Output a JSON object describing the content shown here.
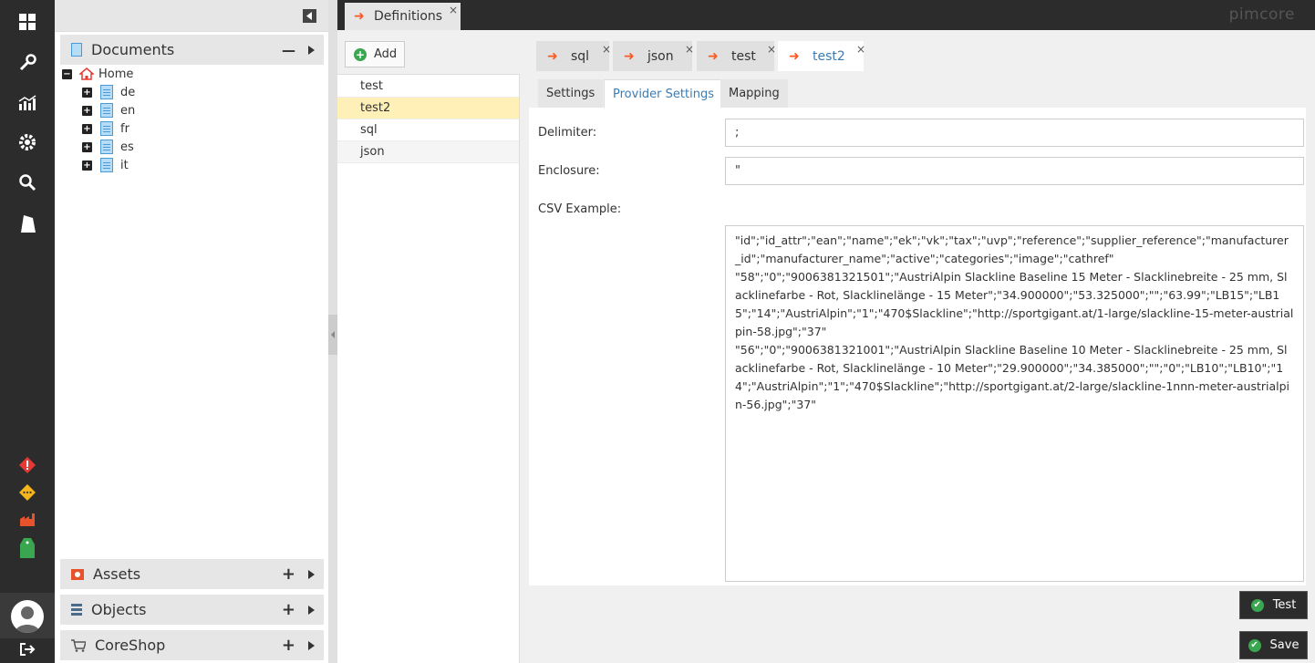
{
  "left_bar": {
    "icons": [
      "dashboard-icon",
      "wrench-icon",
      "chart-icon",
      "gear-icon",
      "search-icon",
      "tag-icon"
    ],
    "status_icons": [
      "error-icon",
      "warning-icon",
      "factory-icon",
      "green-tag-icon"
    ],
    "bottom_icons": [
      "avatar-icon",
      "logout-icon"
    ]
  },
  "tree": {
    "documents_label": "Documents",
    "home_label": "Home",
    "children": [
      "de",
      "en",
      "fr",
      "es",
      "it"
    ],
    "assets_label": "Assets",
    "objects_label": "Objects",
    "coreshop_label": "CoreShop"
  },
  "top": {
    "tab_label": "Definitions",
    "tab_close": "×",
    "logo": "pimcore"
  },
  "list": {
    "add_label": "Add",
    "items": [
      "test",
      "test2",
      "sql",
      "json"
    ],
    "selected_index": 1
  },
  "editor": {
    "open_tabs": [
      {
        "label": "sql",
        "close": "×"
      },
      {
        "label": "json",
        "close": "×"
      },
      {
        "label": "test",
        "close": "×"
      },
      {
        "label": "test2",
        "close": "×"
      }
    ],
    "active_tab": "test2",
    "sub_tabs": [
      "Settings",
      "Provider Settings",
      "Mapping"
    ],
    "active_sub_tab": "Provider Settings",
    "delimiter_label": "Delimiter:",
    "delimiter_value": ";",
    "enclosure_label": "Enclosure:",
    "enclosure_value": "\"",
    "csv_label": "CSV Example:",
    "csv_value": "\"id\";\"id_attr\";\"ean\";\"name\";\"ek\";\"vk\";\"tax\";\"uvp\";\"reference\";\"supplier_reference\";\"manufacturer_id\";\"manufacturer_name\";\"active\";\"categories\";\"image\";\"cathref\"\n\"58\";\"0\";\"9006381321501\";\"AustriAlpin Slackline Baseline 15 Meter - Slacklinebreite - 25 mm, Slacklinefarbe - Rot, Slacklinelänge - 15 Meter\";\"34.900000\";\"53.325000\";\"\";\"63.99\";\"LB15\";\"LB15\";\"14\";\"AustriAlpin\";\"1\";\"470$Slackline\";\"http://sportgigant.at/1-large/slackline-15-meter-austrialpin-58.jpg\";\"37\"\n\"56\";\"0\";\"9006381321001\";\"AustriAlpin Slackline Baseline 10 Meter - Slacklinebreite - 25 mm, Slacklinefarbe - Rot, Slacklinelänge - 10 Meter\";\"29.900000\";\"34.385000\";\"\";\"0\";\"LB10\";\"LB10\";\"14\";\"AustriAlpin\";\"1\";\"470$Slackline\";\"http://sportgigant.at/2-large/slackline-1nnn-meter-austrialpin-56.jpg\";\"37\"",
    "test_button": "Test",
    "save_button": "Save"
  },
  "colors": {
    "accent": "#3c7cb4",
    "selected_row": "#fff0b8",
    "dark": "#2c2c2c",
    "arrow": "#ff5722",
    "success": "#3aa64f"
  }
}
